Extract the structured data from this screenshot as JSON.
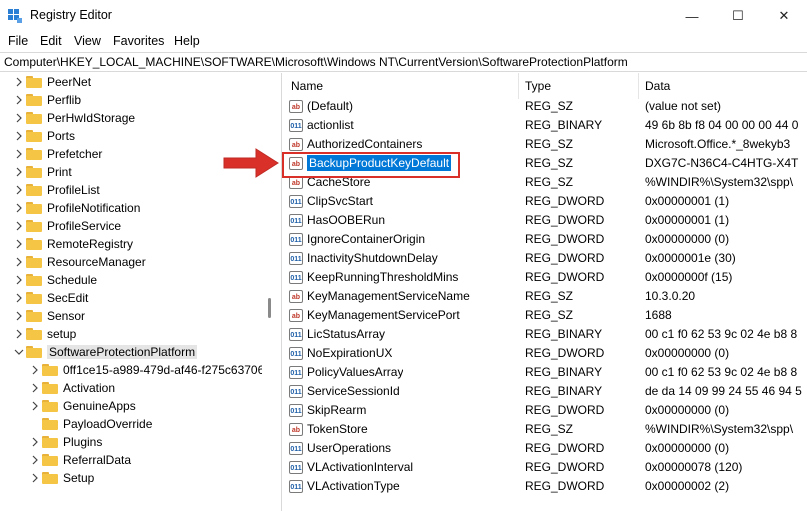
{
  "window": {
    "title": "Registry Editor",
    "minimize_glyph": "—",
    "maximize_glyph": "☐",
    "close_glyph": "✕"
  },
  "menu": {
    "items": [
      {
        "label": "File"
      },
      {
        "label": "Edit"
      },
      {
        "label": "View"
      },
      {
        "label": "Favorites"
      },
      {
        "label": "Help"
      }
    ]
  },
  "address": {
    "path": "Computer\\HKEY_LOCAL_MACHINE\\SOFTWARE\\Microsoft\\Windows NT\\CurrentVersion\\SoftwareProtectionPlatform"
  },
  "tree": {
    "items": [
      {
        "label": "PeerNet",
        "expanded": false,
        "selected": false,
        "level": 1
      },
      {
        "label": "Perflib",
        "expanded": false,
        "selected": false,
        "level": 1
      },
      {
        "label": "PerHwIdStorage",
        "expanded": false,
        "selected": false,
        "level": 1
      },
      {
        "label": "Ports",
        "expanded": false,
        "selected": false,
        "level": 1
      },
      {
        "label": "Prefetcher",
        "expanded": false,
        "selected": false,
        "level": 1
      },
      {
        "label": "Print",
        "expanded": false,
        "selected": false,
        "level": 1
      },
      {
        "label": "ProfileList",
        "expanded": false,
        "selected": false,
        "level": 1
      },
      {
        "label": "ProfileNotification",
        "expanded": false,
        "selected": false,
        "level": 1
      },
      {
        "label": "ProfileService",
        "expanded": false,
        "selected": false,
        "level": 1
      },
      {
        "label": "RemoteRegistry",
        "expanded": false,
        "selected": false,
        "level": 1
      },
      {
        "label": "ResourceManager",
        "expanded": false,
        "selected": false,
        "level": 1
      },
      {
        "label": "Schedule",
        "expanded": false,
        "selected": false,
        "level": 1
      },
      {
        "label": "SecEdit",
        "expanded": false,
        "selected": false,
        "level": 1
      },
      {
        "label": "Sensor",
        "expanded": false,
        "selected": false,
        "level": 1
      },
      {
        "label": "setup",
        "expanded": false,
        "selected": false,
        "level": 1
      },
      {
        "label": "SoftwareProtectionPlatform",
        "expanded": true,
        "selected": true,
        "level": 1
      },
      {
        "label": "0ff1ce15-a989-479d-af46-f275c63706",
        "expanded": false,
        "selected": false,
        "level": 2
      },
      {
        "label": "Activation",
        "expanded": false,
        "selected": false,
        "level": 2
      },
      {
        "label": "GenuineApps",
        "expanded": false,
        "selected": false,
        "level": 2
      },
      {
        "label": "PayloadOverride",
        "expanded": false,
        "selected": false,
        "level": 2,
        "no_chevron": true
      },
      {
        "label": "Plugins",
        "expanded": false,
        "selected": false,
        "level": 2
      },
      {
        "label": "ReferralData",
        "expanded": false,
        "selected": false,
        "level": 2
      },
      {
        "label": "Setup",
        "expanded": false,
        "selected": false,
        "level": 2
      }
    ]
  },
  "list": {
    "headers": {
      "name": "Name",
      "type": "Type",
      "data": "Data"
    },
    "rows": [
      {
        "name": "(Default)",
        "type": "REG_SZ",
        "data": "(value not set)",
        "icon": "ab"
      },
      {
        "name": "actionlist",
        "type": "REG_BINARY",
        "data": "49 6b 8b f8 04 00 00 00 44 0",
        "icon": "bin"
      },
      {
        "name": "AuthorizedContainers",
        "type": "REG_SZ",
        "data": "Microsoft.Office.*_8wekyb3",
        "icon": "ab"
      },
      {
        "name": "BackupProductKeyDefault",
        "type": "REG_SZ",
        "data": "DXG7C-N36C4-C4HTG-X4T",
        "icon": "ab",
        "selected": true
      },
      {
        "name": "CacheStore",
        "type": "REG_SZ",
        "data": "%WINDIR%\\System32\\spp\\",
        "icon": "ab"
      },
      {
        "name": "ClipSvcStart",
        "type": "REG_DWORD",
        "data": "0x00000001 (1)",
        "icon": "bin"
      },
      {
        "name": "HasOOBERun",
        "type": "REG_DWORD",
        "data": "0x00000001 (1)",
        "icon": "bin"
      },
      {
        "name": "IgnoreContainerOrigin",
        "type": "REG_DWORD",
        "data": "0x00000000 (0)",
        "icon": "bin"
      },
      {
        "name": "InactivityShutdownDelay",
        "type": "REG_DWORD",
        "data": "0x0000001e (30)",
        "icon": "bin"
      },
      {
        "name": "KeepRunningThresholdMins",
        "type": "REG_DWORD",
        "data": "0x0000000f (15)",
        "icon": "bin"
      },
      {
        "name": "KeyManagementServiceName",
        "type": "REG_SZ",
        "data": "10.3.0.20",
        "icon": "ab"
      },
      {
        "name": "KeyManagementServicePort",
        "type": "REG_SZ",
        "data": "1688",
        "icon": "ab"
      },
      {
        "name": "LicStatusArray",
        "type": "REG_BINARY",
        "data": "00 c1 f0 62 53 9c 02 4e b8 8",
        "icon": "bin"
      },
      {
        "name": "NoExpirationUX",
        "type": "REG_DWORD",
        "data": "0x00000000 (0)",
        "icon": "bin"
      },
      {
        "name": "PolicyValuesArray",
        "type": "REG_BINARY",
        "data": "00 c1 f0 62 53 9c 02 4e b8 8",
        "icon": "bin"
      },
      {
        "name": "ServiceSessionId",
        "type": "REG_BINARY",
        "data": "de da 14 09 99 24 55 46 94 5",
        "icon": "bin"
      },
      {
        "name": "SkipRearm",
        "type": "REG_DWORD",
        "data": "0x00000000 (0)",
        "icon": "bin"
      },
      {
        "name": "TokenStore",
        "type": "REG_SZ",
        "data": "%WINDIR%\\System32\\spp\\",
        "icon": "ab"
      },
      {
        "name": "UserOperations",
        "type": "REG_DWORD",
        "data": "0x00000000 (0)",
        "icon": "bin"
      },
      {
        "name": "VLActivationInterval",
        "type": "REG_DWORD",
        "data": "0x00000078 (120)",
        "icon": "bin"
      },
      {
        "name": "VLActivationType",
        "type": "REG_DWORD",
        "data": "0x00000002 (2)",
        "icon": "bin"
      }
    ]
  },
  "colors": {
    "selection_blue": "#0078d7",
    "annotation_red": "#d9312a",
    "folder_yellow": "#f5c545"
  },
  "icons": {
    "string_value": "ab-string-icon",
    "binary_value": "binary-value-icon",
    "folder": "folder-icon",
    "arrow": "annotation-arrow-icon"
  }
}
